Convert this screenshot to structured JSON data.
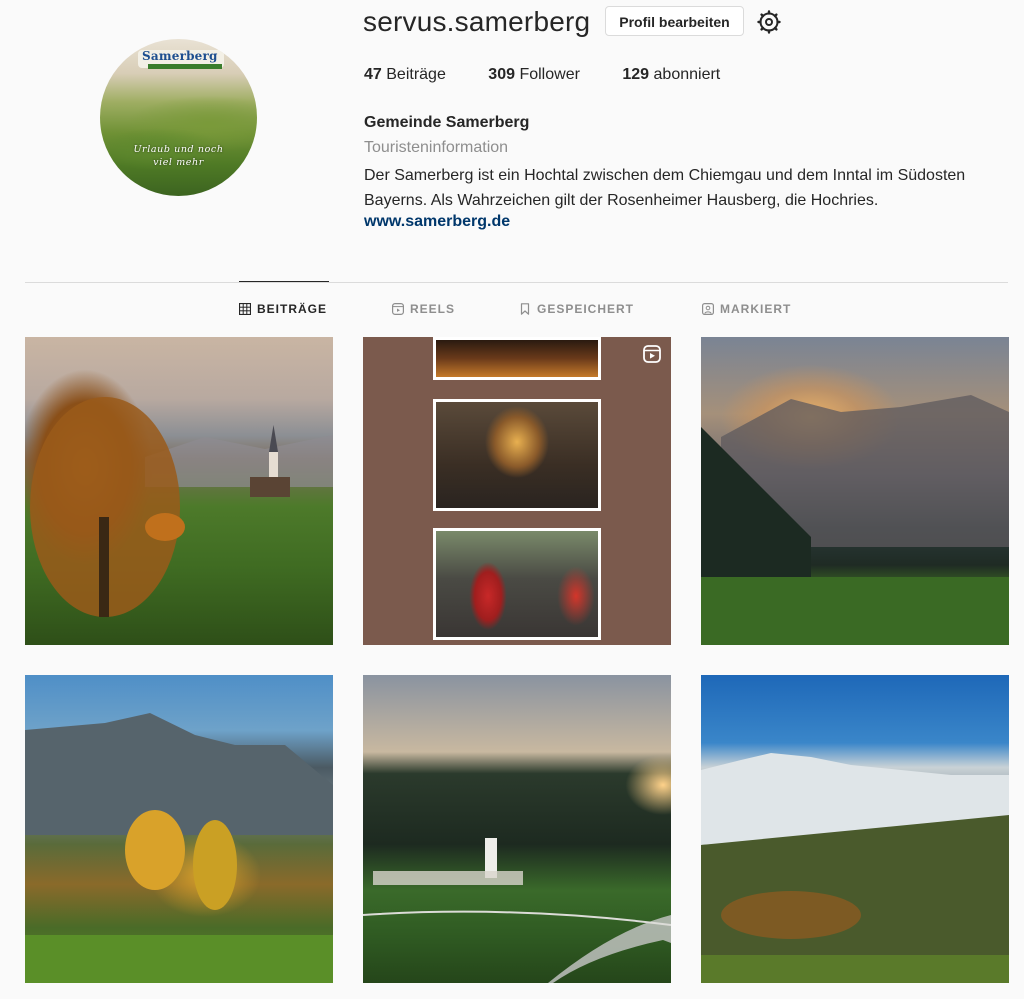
{
  "profile": {
    "username": "servus.samerberg",
    "edit_label": "Profil bearbeiten",
    "avatar": {
      "logo_text": "Samerberg",
      "tagline": "Urlaub und noch\nviel mehr"
    },
    "stats": {
      "posts_count": "47",
      "posts_label": "Beiträge",
      "followers_count": "309",
      "followers_label": "Follower",
      "following_count": "129",
      "following_label": "abonniert"
    },
    "full_name": "Gemeinde Samerberg",
    "category": "Touristeninformation",
    "bio": "Der Samerberg ist ein Hochtal zwischen dem Chiemgau und dem Inntal im Südosten Bayerns. Als Wahrzeichen gilt der Rosenheimer Hausberg, die Hochries.",
    "website": "www.samerberg.de"
  },
  "tabs": [
    {
      "label": "BEITRÄGE",
      "icon": "grid-icon",
      "active": true
    },
    {
      "label": "REELS",
      "icon": "reels-icon",
      "active": false
    },
    {
      "label": "GESPEICHERT",
      "icon": "bookmark-icon",
      "active": false
    },
    {
      "label": "MARKIERT",
      "icon": "tagged-icon",
      "active": false
    }
  ],
  "posts": [
    {
      "subject": "autumn-tree-church-landscape"
    },
    {
      "subject": "christmas-market-church-saint-nicholas",
      "is_reel": true
    },
    {
      "subject": "mountain-sunrise-meadow"
    },
    {
      "subject": "mountain-autumn-forest"
    },
    {
      "subject": "village-church-road-sunset"
    },
    {
      "subject": "snowy-mountain-autumn-valley"
    }
  ],
  "colors": {
    "text": "#262626",
    "muted": "#8e8e8e",
    "link": "#00376b",
    "border": "#dbdbdb",
    "background": "#fafafa"
  }
}
